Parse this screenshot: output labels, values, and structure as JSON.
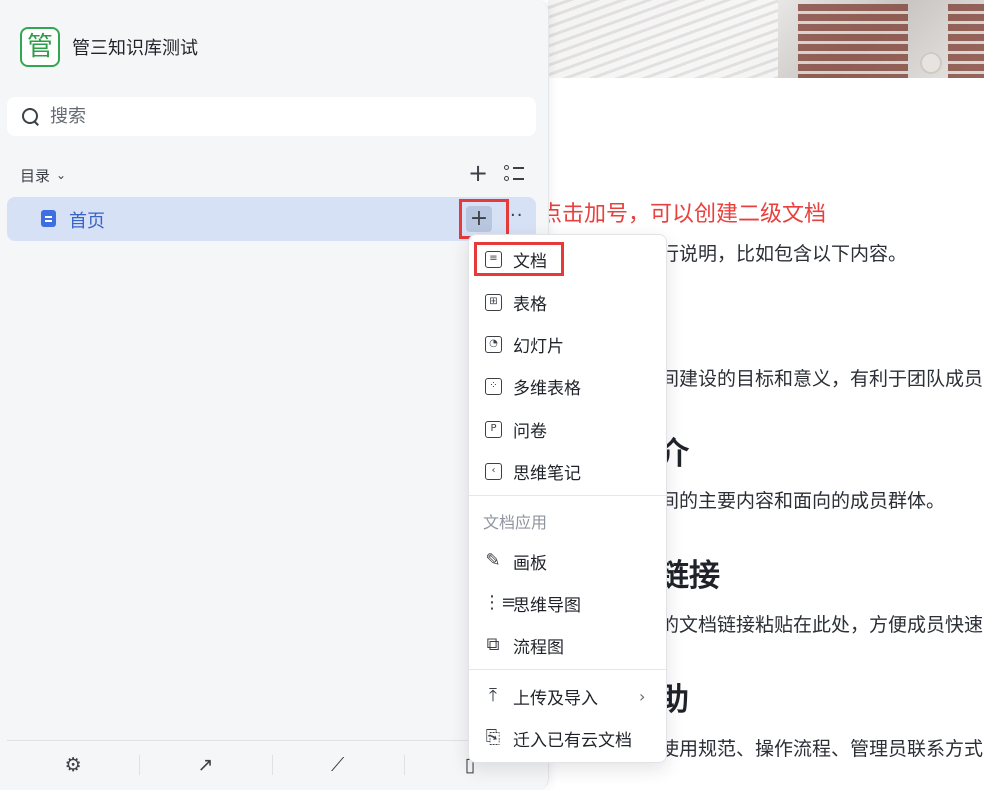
{
  "sidebar": {
    "logo_char": "管",
    "kb_title": "管三知识库测试",
    "search_placeholder": "搜索",
    "toc_label": "目录",
    "nav_item": "首页"
  },
  "annotation": "点击加号，可以创建二级文档",
  "menu": {
    "items": [
      "文档",
      "表格",
      "幻灯片",
      "多维表格",
      "问卷",
      "思维笔记"
    ],
    "section_title": "文档应用",
    "apps": [
      "画板",
      "思维导图",
      "流程图"
    ],
    "upload": "上传及导入",
    "migrate": "迁入已有云文档"
  },
  "doc": {
    "lines": [
      "行说明，比如包含以下内容。",
      "间建设的目标和意义，有利于团队成员",
      "介",
      "间的主要内容和面向的成员群体。",
      "链接",
      "的文档链接粘贴在此处，方便成员快速",
      "助",
      "使用规范、操作流程、管理员联系方式"
    ]
  },
  "colors": {
    "accent": "#3d6fe0",
    "selected_bg": "#d6e1f6",
    "highlight": "#e5393a",
    "annotation": "#e8403d",
    "logo_green": "#2e9d49"
  }
}
